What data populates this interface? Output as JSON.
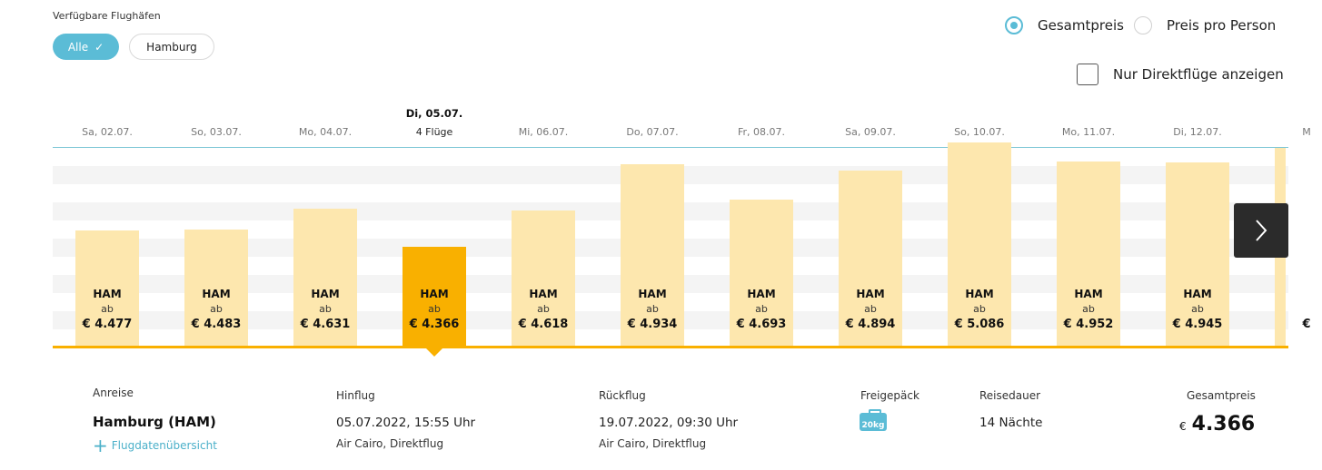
{
  "filters": {
    "airports_label": "Verfügbare Flughäfen",
    "chips": [
      {
        "label": "Alle",
        "selected": true
      },
      {
        "label": "Hamburg",
        "selected": false
      }
    ],
    "price_mode": {
      "total_label": "Gesamtpreis",
      "per_person_label": "Preis pro Person",
      "selected": "total"
    },
    "direct_only_label": "Nur Direktflüge anzeigen",
    "direct_only_checked": false
  },
  "dates": [
    {
      "label": "Sa, 02.07."
    },
    {
      "label": "So, 03.07."
    },
    {
      "label": "Mo, 04.07."
    },
    {
      "label": "Di, 05.07.",
      "flights": "4 Flüge",
      "active": true
    },
    {
      "label": "Mi, 06.07."
    },
    {
      "label": "Do, 07.07."
    },
    {
      "label": "Fr, 08.07."
    },
    {
      "label": "Sa, 09.07."
    },
    {
      "label": "So, 10.07."
    },
    {
      "label": "Mo, 11.07."
    },
    {
      "label": "Di, 12.07."
    },
    {
      "label": "M"
    }
  ],
  "bars": [
    {
      "code": "HAM",
      "ab": "ab",
      "price": "€ 4.477",
      "value": 4477
    },
    {
      "code": "HAM",
      "ab": "ab",
      "price": "€ 4.483",
      "value": 4483
    },
    {
      "code": "HAM",
      "ab": "ab",
      "price": "€ 4.631",
      "value": 4631
    },
    {
      "code": "HAM",
      "ab": "ab",
      "price": "€ 4.366",
      "value": 4366,
      "active": true
    },
    {
      "code": "HAM",
      "ab": "ab",
      "price": "€ 4.618",
      "value": 4618
    },
    {
      "code": "HAM",
      "ab": "ab",
      "price": "€ 4.934",
      "value": 4934
    },
    {
      "code": "HAM",
      "ab": "ab",
      "price": "€ 4.693",
      "value": 4693
    },
    {
      "code": "HAM",
      "ab": "ab",
      "price": "€ 4.894",
      "value": 4894
    },
    {
      "code": "HAM",
      "ab": "ab",
      "price": "€ 5.086",
      "value": 5086
    },
    {
      "code": "HAM",
      "ab": "ab",
      "price": "€ 4.952",
      "value": 4952
    },
    {
      "code": "HAM",
      "ab": "ab",
      "price": "€ 4.945",
      "value": 4945
    },
    {
      "code": "",
      "ab": "",
      "price": "€",
      "value": 5050
    }
  ],
  "details": {
    "anreise_label": "Anreise",
    "origin": "Hamburg  (HAM)",
    "overview_link": "Flugdatenübersicht",
    "hinflug_label": "Hinflug",
    "hinflug_time": "05.07.2022, 15:55 Uhr",
    "hinflug_airline": "Air Cairo, Direktflug",
    "rueckflug_label": "Rückflug",
    "rueckflug_time": "19.07.2022, 09:30 Uhr",
    "rueckflug_airline": "Air Cairo, Direktflug",
    "baggage_label": "Freigepäck",
    "baggage_value": "20kg",
    "duration_label": "Reisedauer",
    "duration_value": "14 Nächte",
    "total_label": "Gesamtpreis",
    "total_currency": "€",
    "total_amount": "4.366"
  },
  "colors": {
    "accent": "#5bbcd6",
    "bar": "#fde7ae",
    "bar_active": "#f9b000"
  },
  "icons": {
    "check": "check-icon",
    "next": "chevron-right-icon",
    "plus": "plus-icon",
    "baggage": "suitcase-icon"
  }
}
